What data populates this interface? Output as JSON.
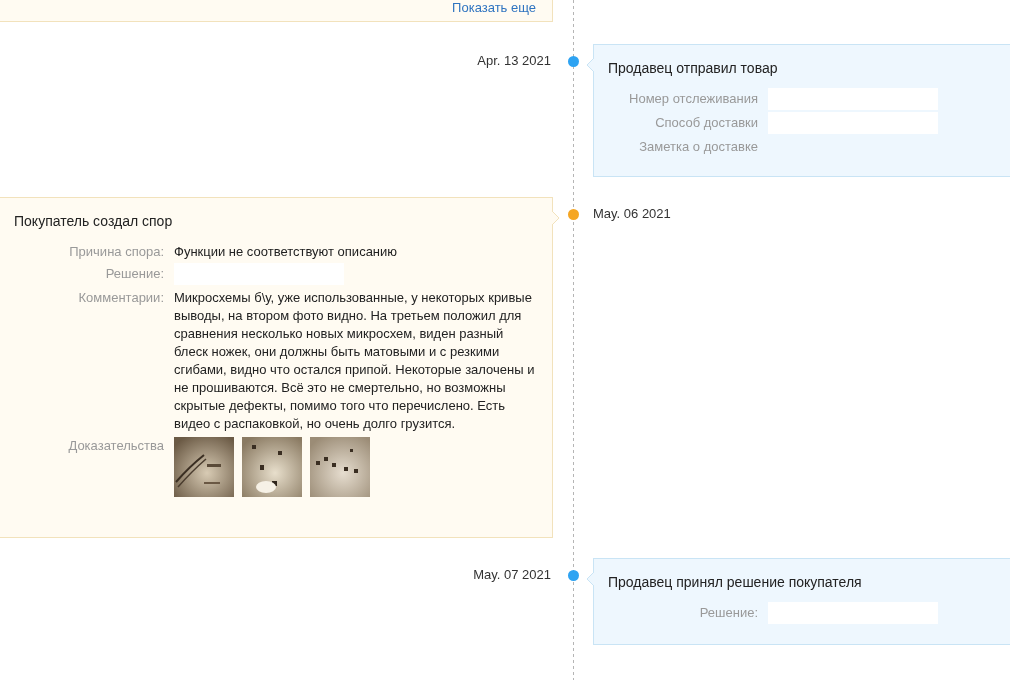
{
  "previous_card": {
    "link": "Показать еще"
  },
  "events": [
    {
      "kind": "seller",
      "color": "#2ea3f2",
      "date": "Apr. 13 2021",
      "title": "Продавец отправил товар",
      "fields": [
        {
          "label": "Номер отслеживания",
          "kind": "blank"
        },
        {
          "label": "Способ доставки",
          "kind": "blank"
        },
        {
          "label": "Заметка о доставке",
          "kind": "empty"
        }
      ]
    },
    {
      "kind": "buyer",
      "color": "#f5a623",
      "date": "May. 06 2021",
      "title": "Покупатель создал спор",
      "fields": [
        {
          "label": "Причина спора:",
          "kind": "text",
          "value": "Функции не соответствуют описанию"
        },
        {
          "label": "Решение:",
          "kind": "blank"
        },
        {
          "label": "Комментарии:",
          "kind": "text",
          "value": "Микросхемы б\\у, уже использованные, у некоторых кривые выводы, на втором фото видно. На третьем положил для сравнения несколько новых микросхем, виден разный блеск ножек, они должны быть матовыми и с резкими сгибами, видно что остался припой. Некоторые залочены и не прошиваются. Всё это не смертельно, но возможны скрытые дефекты, помимо того что перечислено. Есть видео с распаковкой, но очень долго грузится."
        },
        {
          "label": "Доказательства",
          "kind": "photos"
        }
      ]
    },
    {
      "kind": "seller",
      "color": "#2ea3f2",
      "date": "May. 07 2021",
      "title": "Продавец принял решение покупателя",
      "fields": [
        {
          "label": "Решение:",
          "kind": "blank"
        }
      ]
    }
  ]
}
